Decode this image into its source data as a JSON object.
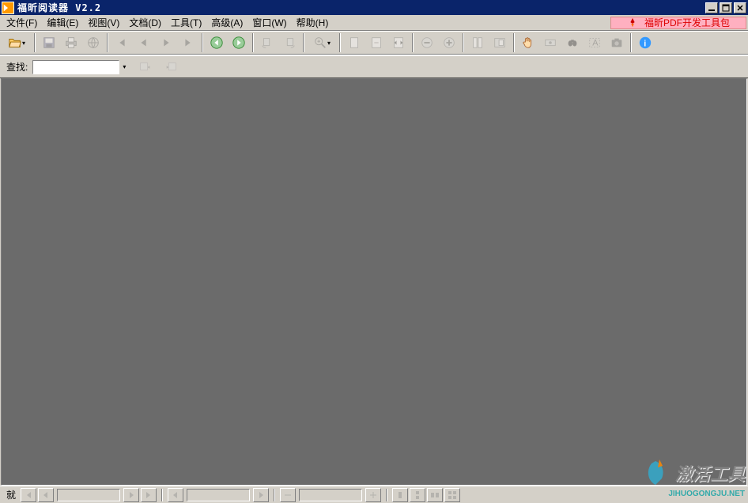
{
  "title": "福昕阅读器 V2.2",
  "menu": [
    "文件(F)",
    "编辑(E)",
    "视图(V)",
    "文档(D)",
    "工具(T)",
    "高级(A)",
    "窗口(W)",
    "帮助(H)"
  ],
  "ad_text": "福昕PDF开发工具包",
  "find_label": "查找:",
  "find_value": "",
  "status_label": "就",
  "watermark": "激活工具",
  "watermark_sub": "JIHUOGONGJU.NET"
}
